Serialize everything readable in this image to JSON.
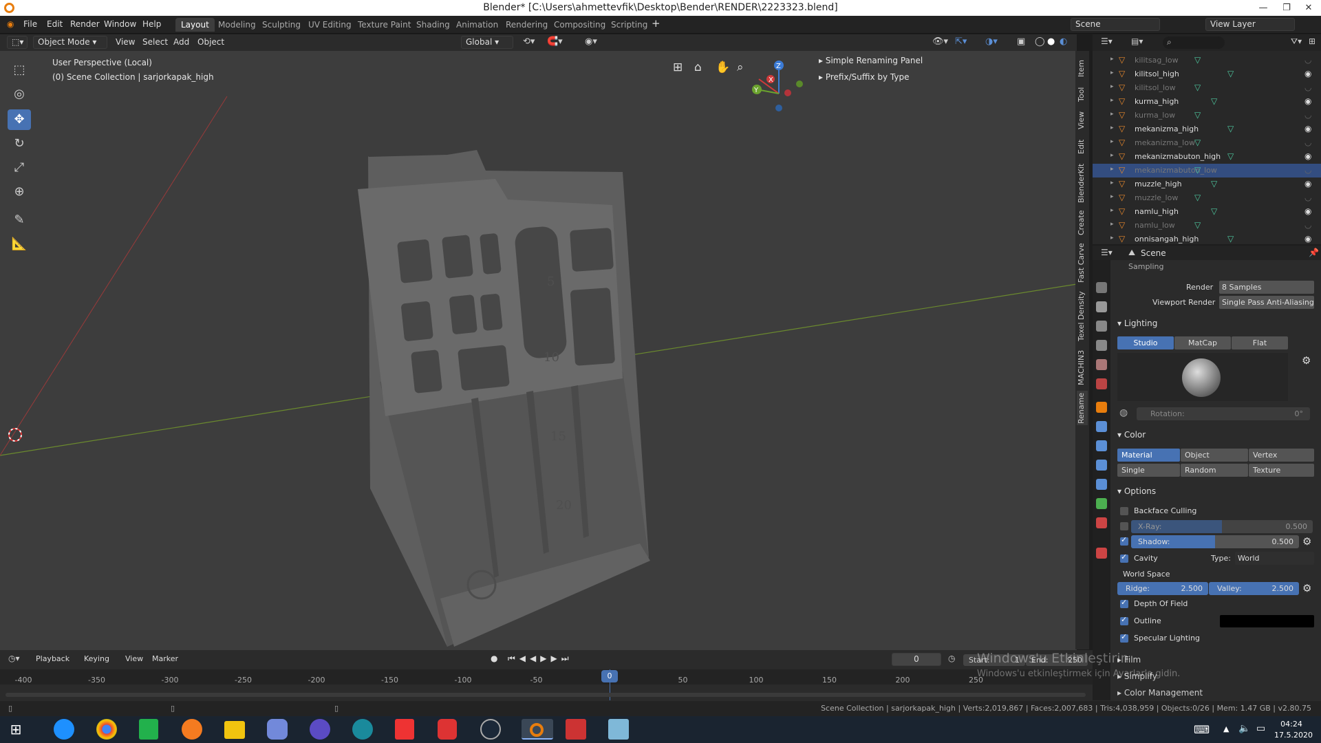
{
  "window": {
    "title": "Blender* [C:\\Users\\ahmettevfik\\Desktop\\Bender\\RENDER\\2223323.blend]",
    "minimize": "—",
    "restore": "❐",
    "close": "✕"
  },
  "menu": [
    "File",
    "Edit",
    "Render",
    "Window",
    "Help"
  ],
  "workspaces": [
    "Layout",
    "Modeling",
    "Sculpting",
    "UV Editing",
    "Texture Paint",
    "Shading",
    "Animation",
    "Rendering",
    "Compositing",
    "Scripting"
  ],
  "active_workspace": "Layout",
  "scene": "Scene",
  "view_layer": "View Layer",
  "viewport": {
    "mode": "Object Mode",
    "menus": [
      "View",
      "Select",
      "Add",
      "Object"
    ],
    "orientation": "Global",
    "overlay_line1": "User Perspective (Local)",
    "overlay_line2": "(0) Scene Collection | sarjorkapak_high",
    "panel1": "Simple Renaming Panel",
    "panel2": "Prefix/Suffix by Type",
    "gizmo_x": "X",
    "gizmo_y": "Y",
    "gizmo_z": "Z",
    "model_marks": [
      "5",
      "10",
      "15",
      "20"
    ]
  },
  "ntabs": [
    "Item",
    "Tool",
    "View",
    "Edit",
    "BlenderKit",
    "Create",
    "Fast Carve",
    "Texel Density",
    "MACHIN3",
    "Rename"
  ],
  "outliner": [
    {
      "name": "kilitsag_low",
      "dim": true
    },
    {
      "name": "kilitsol_high",
      "dim": false
    },
    {
      "name": "kilitsol_low",
      "dim": true
    },
    {
      "name": "kurma_high",
      "dim": false
    },
    {
      "name": "kurma_low",
      "dim": true
    },
    {
      "name": "mekanizma_high",
      "dim": false
    },
    {
      "name": "mekanizma_low",
      "dim": true
    },
    {
      "name": "mekanizmabuton_high",
      "dim": false
    },
    {
      "name": "mekanizmabuton_low",
      "dim": true,
      "selected": true
    },
    {
      "name": "muzzle_high",
      "dim": false
    },
    {
      "name": "muzzle_low",
      "dim": true
    },
    {
      "name": "namlu_high",
      "dim": false
    },
    {
      "name": "namlu_low",
      "dim": true
    },
    {
      "name": "onnisangah_high",
      "dim": false
    }
  ],
  "props": {
    "header": "Scene",
    "sampling": "Sampling",
    "render_label": "Render",
    "render_value": "8 Samples",
    "viewport_render_label": "Viewport Render",
    "viewport_render_value": "Single Pass Anti-Aliasing",
    "lighting": "Lighting",
    "light_modes": [
      "Studio",
      "MatCap",
      "Flat"
    ],
    "rotation_label": "Rotation:",
    "rotation_value": "0°",
    "color": "Color",
    "color_modes": [
      "Material",
      "Object",
      "Vertex",
      "Single",
      "Random",
      "Texture"
    ],
    "options": "Options",
    "backface": "Backface Culling",
    "xray_label": "X-Ray:",
    "xray_value": "0.500",
    "xray_level": 0.5,
    "shadow_label": "Shadow:",
    "shadow_value": "0.500",
    "shadow_level": 0.5,
    "cavity": "Cavity",
    "type_label": "Type:",
    "type_value": "World",
    "world_space": "World Space",
    "ridge_label": "Ridge:",
    "ridge_value": "2.500",
    "valley_label": "Valley:",
    "valley_value": "2.500",
    "dof": "Depth Of Field",
    "outline": "Outline",
    "specular": "Specular Lighting",
    "film": "Film",
    "simplify": "Simplify",
    "color_mgmt": "Color Management"
  },
  "timeline": {
    "menus": [
      "Playback",
      "Keying",
      "View",
      "Marker"
    ],
    "frame": "0",
    "start_label": "Start:",
    "start": "1",
    "end_label": "End:",
    "end": "250",
    "current": "0",
    "ticks": [
      "-400",
      "-350",
      "-300",
      "-250",
      "-200",
      "-150",
      "-100",
      "-50",
      "50",
      "100",
      "150",
      "200",
      "250"
    ]
  },
  "activation": {
    "line1": "Windows'u Etkinleştirin",
    "line2": "Windows'u etkinleştirmek için Ayarlar'a gidin."
  },
  "status": "Scene Collection | sarjorkapak_high | Verts:2,019,867 | Faces:2,007,683 | Tris:4,038,959 | Objects:0/26 | Mem: 1.47 GB | v2.80.75",
  "clock": {
    "time": "04:24",
    "date": "17.5.2020"
  },
  "colors": {
    "accent": "#4772b3",
    "orange": "#e87d0d",
    "viewport": "#3d3d3d"
  }
}
